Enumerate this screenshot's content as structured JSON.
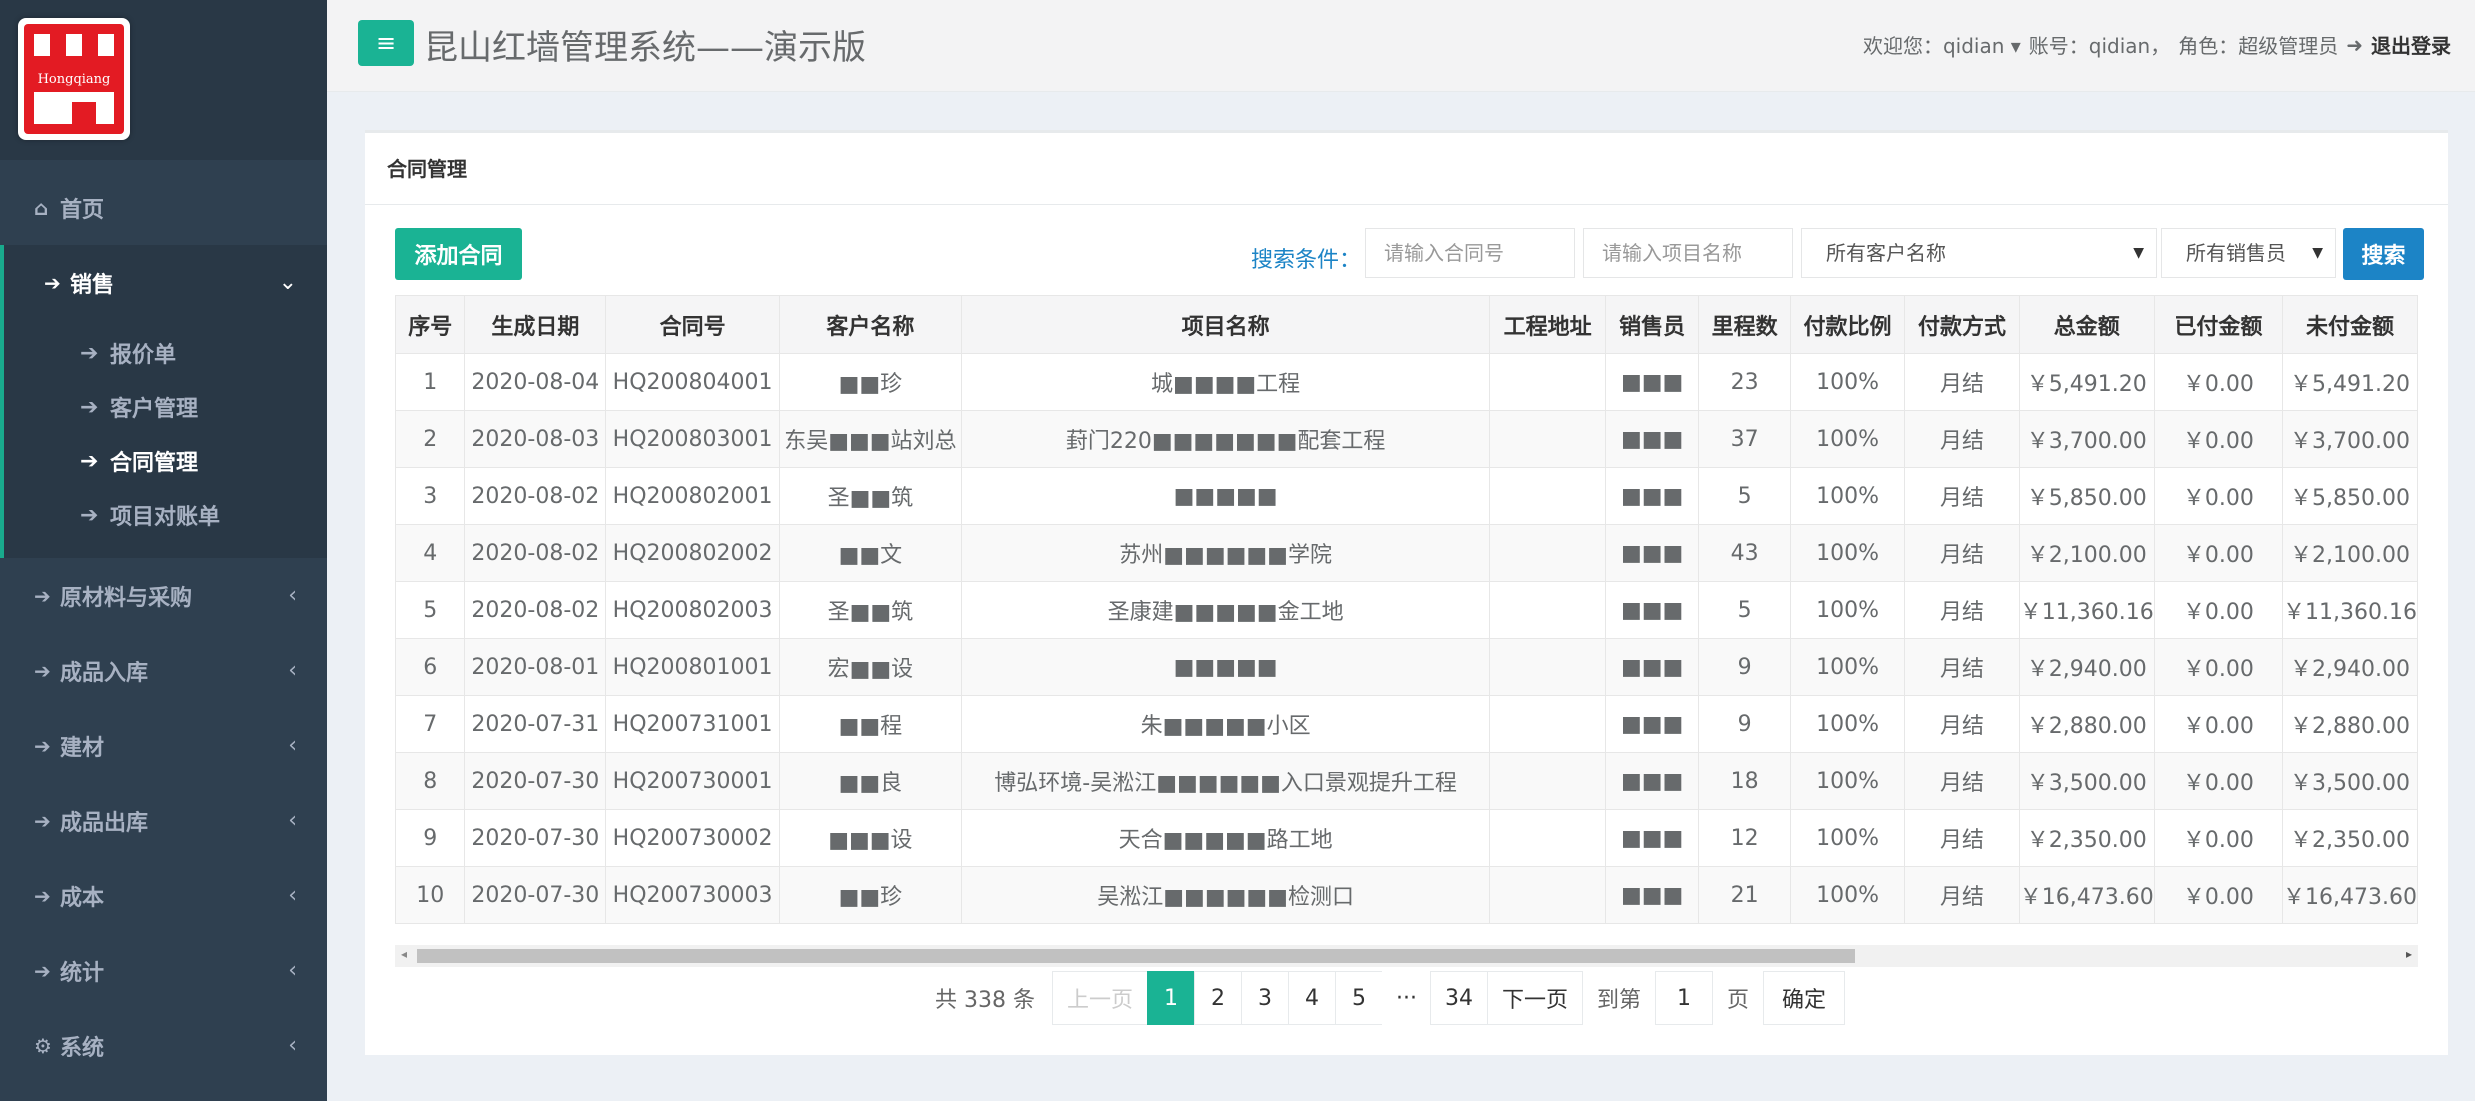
{
  "sidebar": {
    "logo_text": "Hongqiang",
    "home": "首页",
    "sales": "销售",
    "sales_sub": [
      "报价单",
      "客户管理",
      "合同管理",
      "项目对账单"
    ],
    "others": [
      "原材料与采购",
      "成品入库",
      "建材",
      "成品出库",
      "成本",
      "统计",
      "系统"
    ]
  },
  "header": {
    "title": "昆山红墙管理系统——演示版",
    "welcome": "欢迎您：qidian",
    "account": "账号：qidian，",
    "role": "角色：超级管理员",
    "logout": "退出登录"
  },
  "panel": {
    "title": "合同管理"
  },
  "toolbar": {
    "add": "添加合同",
    "search_label": "搜索条件：",
    "contract_placeholder": "请输入合同号",
    "project_placeholder": "请输入项目名称",
    "customer_select": "所有客户名称",
    "seller_select": "所有销售员",
    "search": "搜索"
  },
  "table": {
    "headers": [
      "序号",
      "生成日期",
      "合同号",
      "客户名称",
      "项目名称",
      "工程地址",
      "销售员",
      "里程数",
      "付款比例",
      "付款方式",
      "总金额",
      "已付金额",
      "未付金额"
    ],
    "rows": [
      [
        "1",
        "2020-08-04",
        "HQ200804001",
        "■■珍",
        "城■■■■工程",
        "",
        "■■■",
        "23",
        "100%",
        "月结",
        "￥5,491.20",
        "￥0.00",
        "￥5,491.20"
      ],
      [
        "2",
        "2020-08-03",
        "HQ200803001",
        "东吴■■■站刘总",
        "葑门220■■■■■■■配套工程",
        "",
        "■■■",
        "37",
        "100%",
        "月结",
        "￥3,700.00",
        "￥0.00",
        "￥3,700.00"
      ],
      [
        "3",
        "2020-08-02",
        "HQ200802001",
        "圣■■筑",
        "■■■■■",
        "",
        "■■■",
        "5",
        "100%",
        "月结",
        "￥5,850.00",
        "￥0.00",
        "￥5,850.00"
      ],
      [
        "4",
        "2020-08-02",
        "HQ200802002",
        "■■文",
        "苏州■■■■■■学院",
        "",
        "■■■",
        "43",
        "100%",
        "月结",
        "￥2,100.00",
        "￥0.00",
        "￥2,100.00"
      ],
      [
        "5",
        "2020-08-02",
        "HQ200802003",
        "圣■■筑",
        "圣康建■■■■■金工地",
        "",
        "■■■",
        "5",
        "100%",
        "月结",
        "￥11,360.16",
        "￥0.00",
        "￥11,360.16"
      ],
      [
        "6",
        "2020-08-01",
        "HQ200801001",
        "宏■■设",
        "■■■■■",
        "",
        "■■■",
        "9",
        "100%",
        "月结",
        "￥2,940.00",
        "￥0.00",
        "￥2,940.00"
      ],
      [
        "7",
        "2020-07-31",
        "HQ200731001",
        "■■程",
        "朱■■■■■小区",
        "",
        "■■■",
        "9",
        "100%",
        "月结",
        "￥2,880.00",
        "￥0.00",
        "￥2,880.00"
      ],
      [
        "8",
        "2020-07-30",
        "HQ200730001",
        "■■良",
        "博弘环境-吴淞江■■■■■■入口景观提升工程",
        "",
        "■■■",
        "18",
        "100%",
        "月结",
        "￥3,500.00",
        "￥0.00",
        "￥3,500.00"
      ],
      [
        "9",
        "2020-07-30",
        "HQ200730002",
        "■■■设",
        "天合■■■■■路工地",
        "",
        "■■■",
        "12",
        "100%",
        "月结",
        "￥2,350.00",
        "￥0.00",
        "￥2,350.00"
      ],
      [
        "10",
        "2020-07-30",
        "HQ200730003",
        "■■珍",
        "吴淞江■■■■■■检测口",
        "",
        "■■■",
        "21",
        "100%",
        "月结",
        "￥16,473.60",
        "￥0.00",
        "￥16,473.60"
      ]
    ]
  },
  "pager": {
    "total": "共 338 条",
    "prev": "上一页",
    "pages": [
      "1",
      "2",
      "3",
      "4",
      "5"
    ],
    "ellipsis": "···",
    "last": "34",
    "next": "下一页",
    "goto": "到第",
    "goto_value": "1",
    "page_unit": "页",
    "confirm": "确定"
  }
}
